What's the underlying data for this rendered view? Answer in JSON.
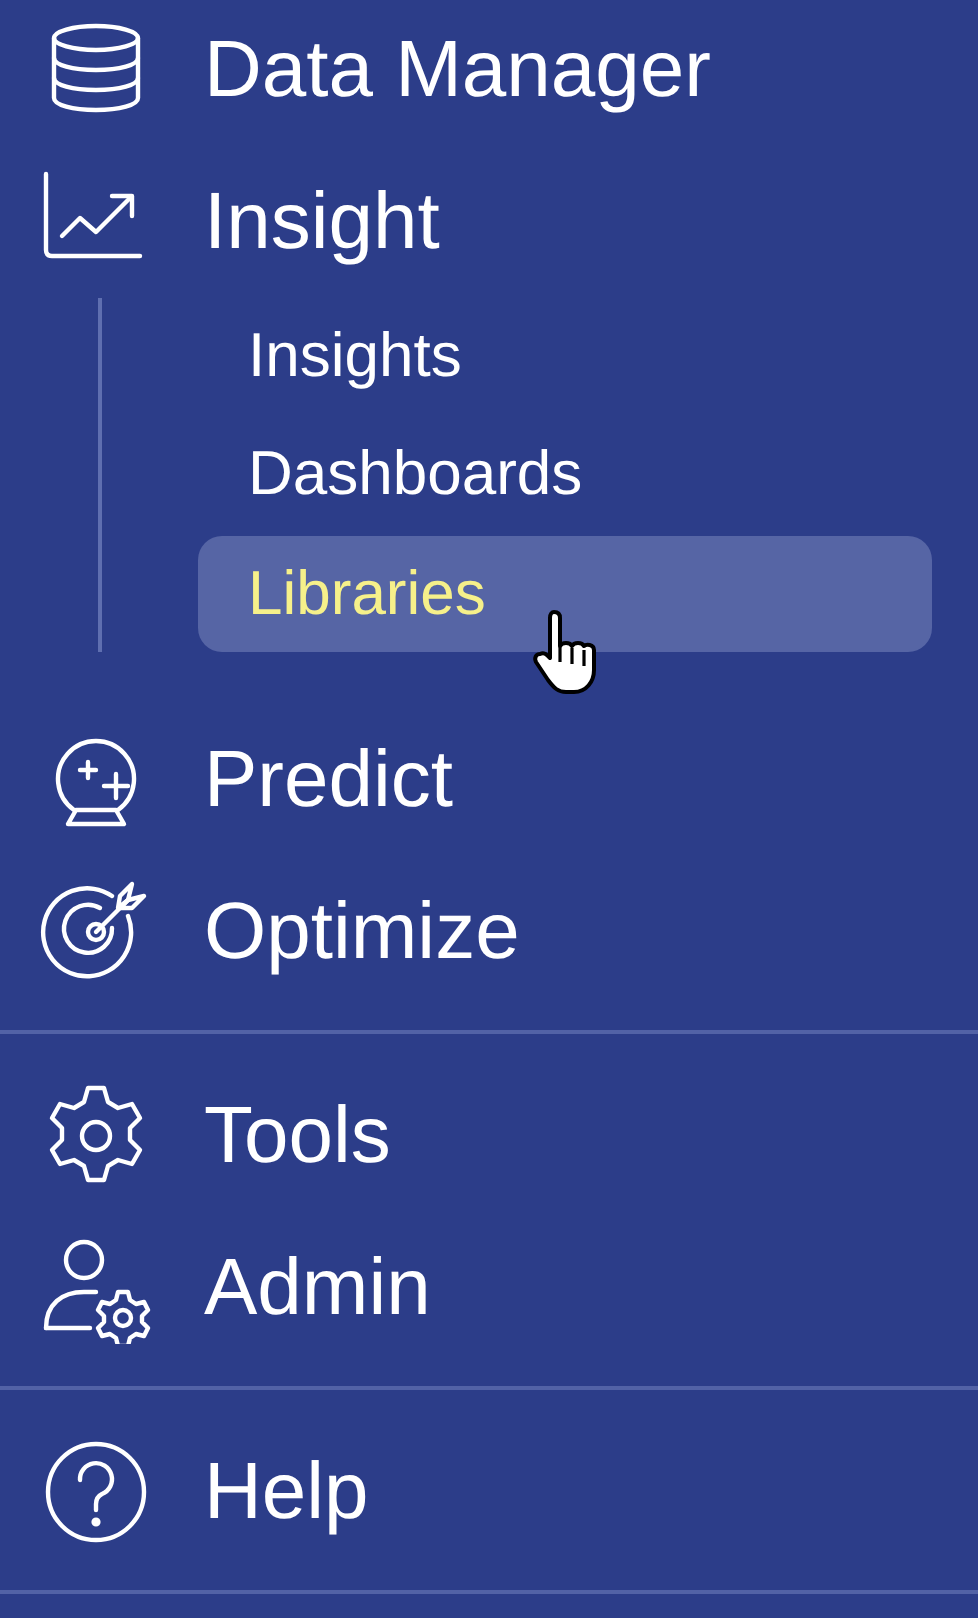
{
  "sections": [
    {
      "items": [
        {
          "label": "Data Manager",
          "kind": "database"
        },
        {
          "label": "Insight",
          "kind": "chart",
          "children": [
            {
              "label": "Insights",
              "selected": false
            },
            {
              "label": "Dashboards",
              "selected": false
            },
            {
              "label": "Libraries",
              "selected": true
            }
          ]
        },
        {
          "label": "Predict",
          "kind": "crystal"
        },
        {
          "label": "Optimize",
          "kind": "target"
        }
      ]
    },
    {
      "items": [
        {
          "label": "Tools",
          "kind": "gear"
        },
        {
          "label": "Admin",
          "kind": "admin"
        }
      ]
    },
    {
      "items": [
        {
          "label": "Help",
          "kind": "help"
        }
      ]
    }
  ]
}
